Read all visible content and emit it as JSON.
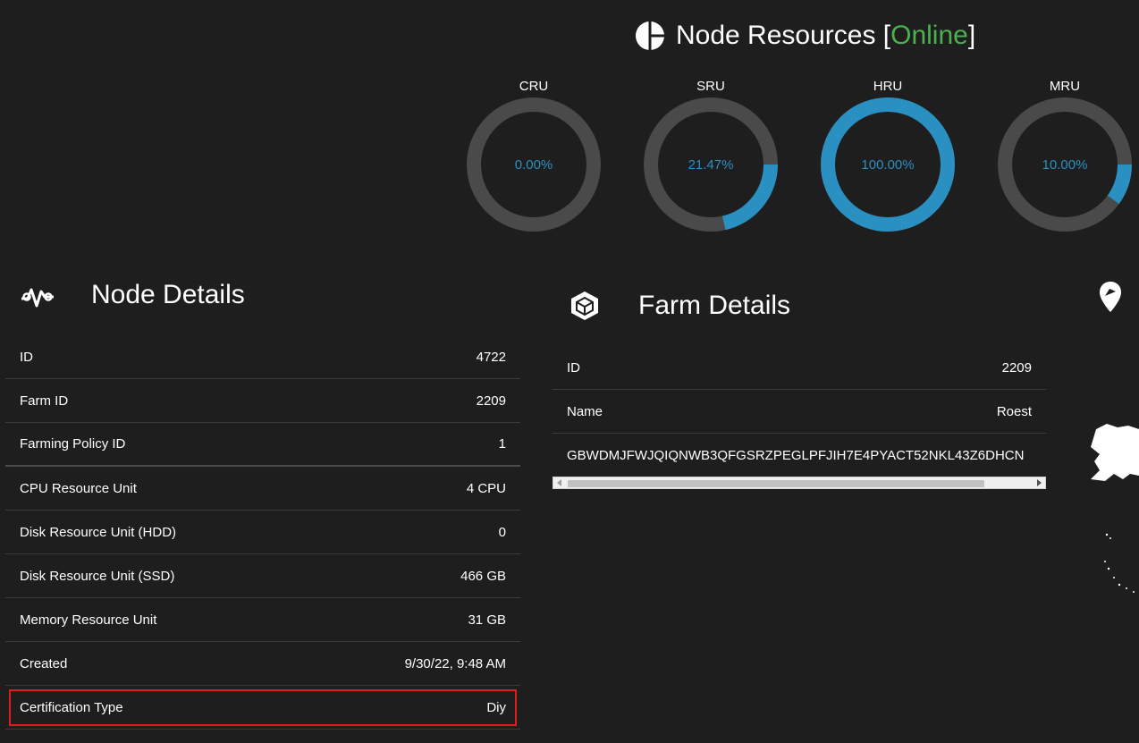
{
  "resources": {
    "title_prefix": "Node Resources [",
    "status": "Online",
    "title_suffix": "]",
    "status_color": "#4caf50",
    "accent_color": "#2a8fc1",
    "gauges": [
      {
        "label": "CRU",
        "value_text": "0.00%",
        "fraction": 0.0
      },
      {
        "label": "SRU",
        "value_text": "21.47%",
        "fraction": 0.2147
      },
      {
        "label": "HRU",
        "value_text": "100.00%",
        "fraction": 1.0
      },
      {
        "label": "MRU",
        "value_text": "10.00%",
        "fraction": 0.1
      }
    ]
  },
  "node_details": {
    "title": "Node Details",
    "icon": "pulse-icon",
    "rows": [
      {
        "key": "ID",
        "value": "4722"
      },
      {
        "key": "Farm ID",
        "value": "2209"
      },
      {
        "key": "Farming Policy ID",
        "value": "1"
      },
      {
        "key": "CPU Resource Unit",
        "value": "4 CPU"
      },
      {
        "key": "Disk Resource Unit (HDD)",
        "value": "0"
      },
      {
        "key": "Disk Resource Unit (SSD)",
        "value": "466 GB"
      },
      {
        "key": "Memory Resource Unit",
        "value": "31 GB"
      },
      {
        "key": "Created",
        "value": "9/30/22, 9:48 AM"
      },
      {
        "key": "Certification Type",
        "value": "Diy"
      }
    ]
  },
  "farm_details": {
    "title": "Farm Details",
    "icon": "cube-icon",
    "rows": [
      {
        "key": "ID",
        "value": "2209"
      },
      {
        "key": "Name",
        "value": "Roest"
      }
    ],
    "address": "GBWDMJFWJQIQNWB3QFGSRZPEGLPFJIH7E4PYACT52NKL43Z6DHCN"
  },
  "map": {
    "icon": "map-pin-icon"
  }
}
